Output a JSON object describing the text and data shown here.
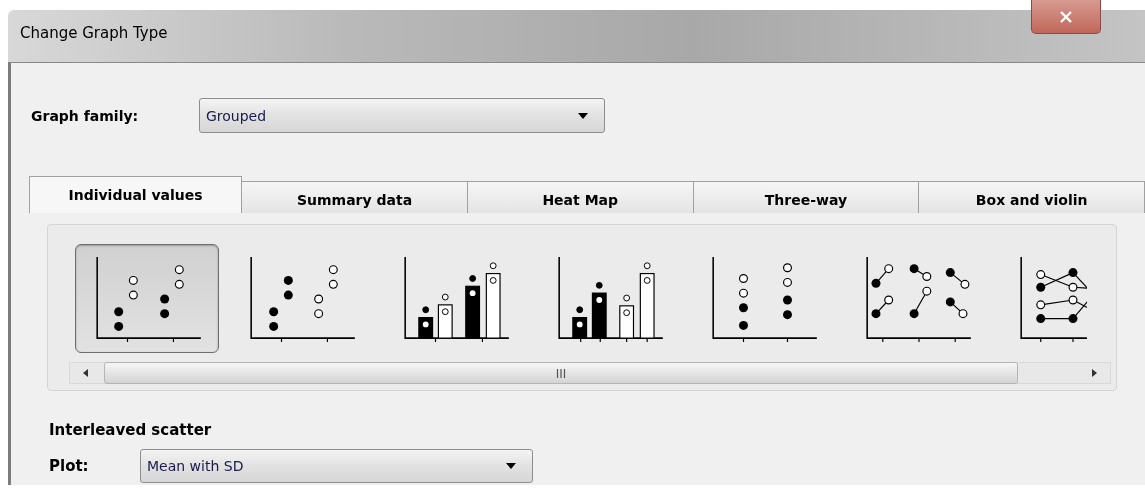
{
  "window": {
    "title": "Change Graph Type"
  },
  "graph_family": {
    "label": "Graph family:",
    "value": "Grouped"
  },
  "tabs": [
    {
      "label": "Individual values",
      "selected": true
    },
    {
      "label": "Summary data",
      "selected": false
    },
    {
      "label": "Heat Map",
      "selected": false
    },
    {
      "label": "Three-way",
      "selected": false
    },
    {
      "label": "Box and violin",
      "selected": false
    }
  ],
  "gallery": [
    {
      "kind": "interleaved-scatter",
      "selected": true
    },
    {
      "kind": "grouped-scatter",
      "selected": false
    },
    {
      "kind": "interleaved-bars",
      "selected": false
    },
    {
      "kind": "grouped-bars",
      "selected": false
    },
    {
      "kind": "stacked-dots",
      "selected": false
    },
    {
      "kind": "before-after",
      "selected": false
    },
    {
      "kind": "lines",
      "selected": false
    }
  ],
  "selection_title": "Interleaved scatter",
  "plot": {
    "label": "Plot:",
    "value": "Mean with SD"
  }
}
